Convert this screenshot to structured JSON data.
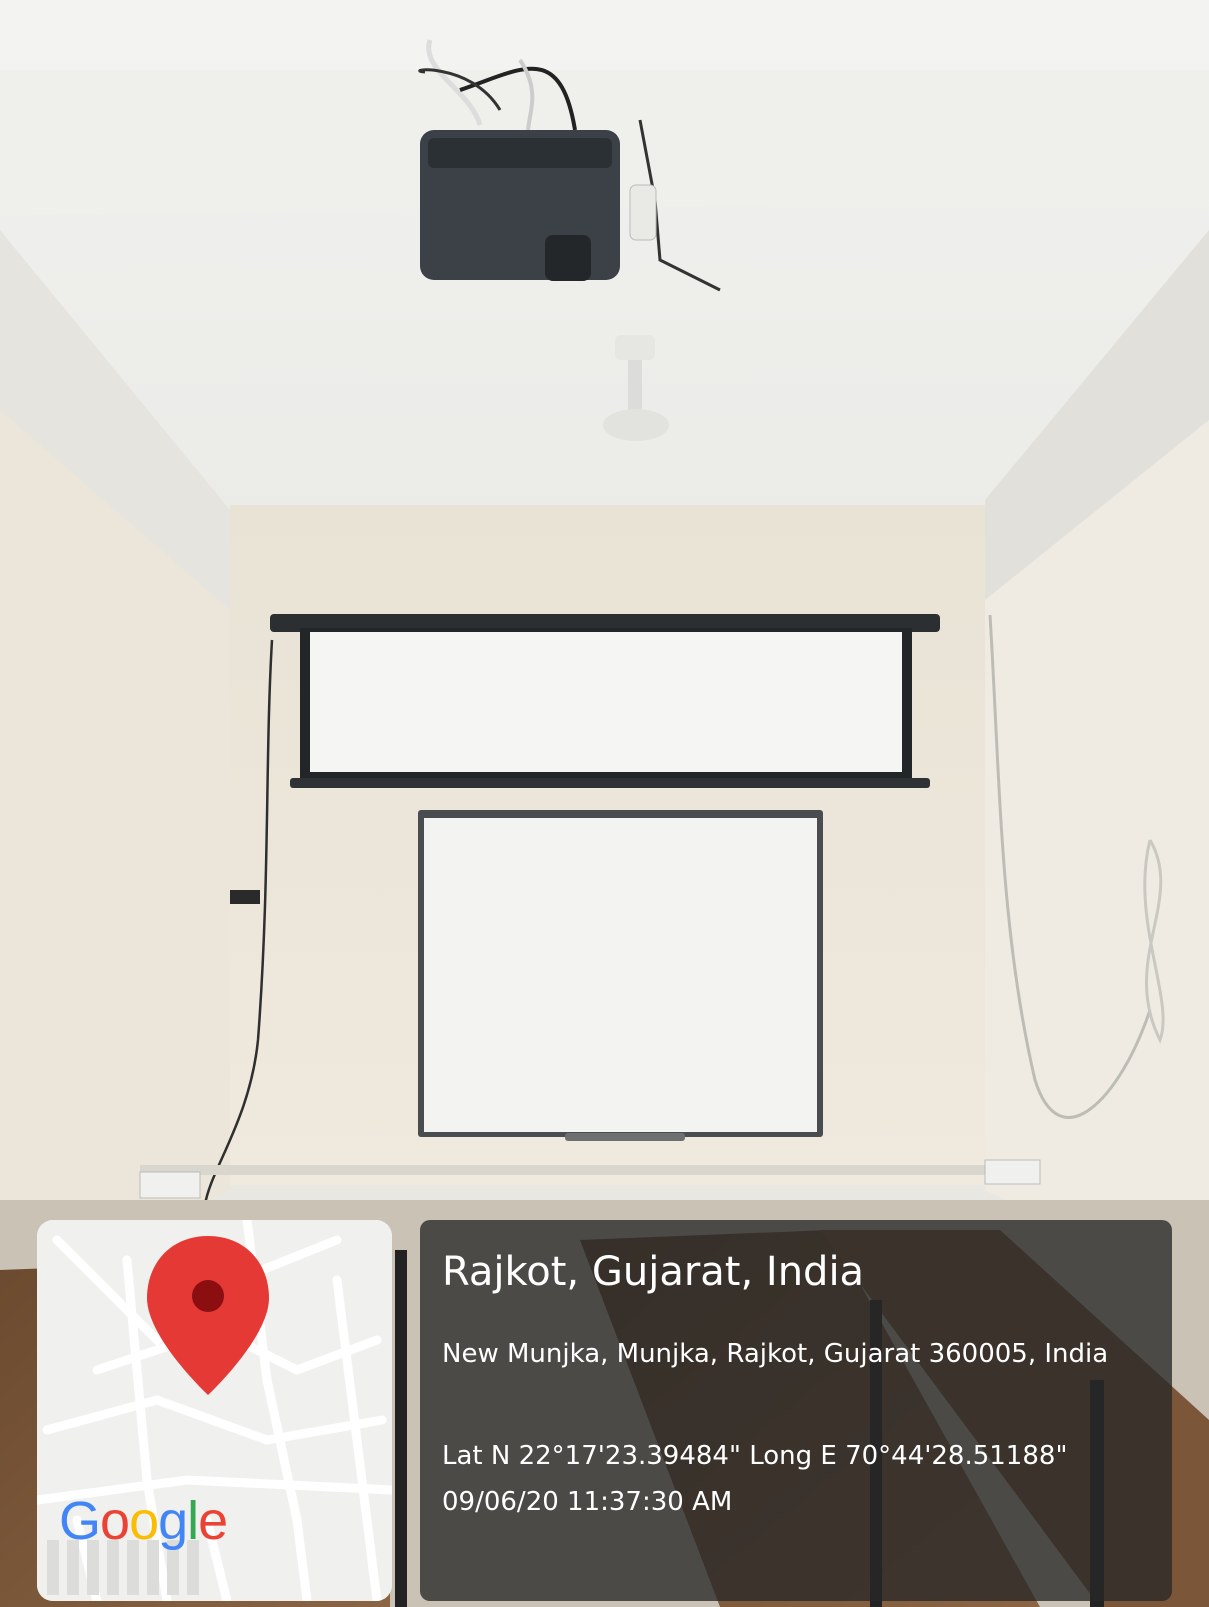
{
  "map_card": {
    "google_letters": [
      {
        "ch": "G",
        "color": "#4285F4"
      },
      {
        "ch": "o",
        "color": "#EA4335"
      },
      {
        "ch": "o",
        "color": "#FBBC05"
      },
      {
        "ch": "g",
        "color": "#4285F4"
      },
      {
        "ch": "l",
        "color": "#34A853"
      },
      {
        "ch": "e",
        "color": "#EA4335"
      }
    ],
    "pin_color": "#E53935",
    "pin_icon": "map-pin-icon"
  },
  "info": {
    "city": "Rajkot, Gujarat, India",
    "address": "New Munjka, Munjka, Rajkot, Gujarat 360005, India",
    "coordinates": "Lat N 22°17'23.39484\" Long E 70°44'28.51188\"",
    "timestamp": "09/06/20 11:37:30 AM"
  }
}
